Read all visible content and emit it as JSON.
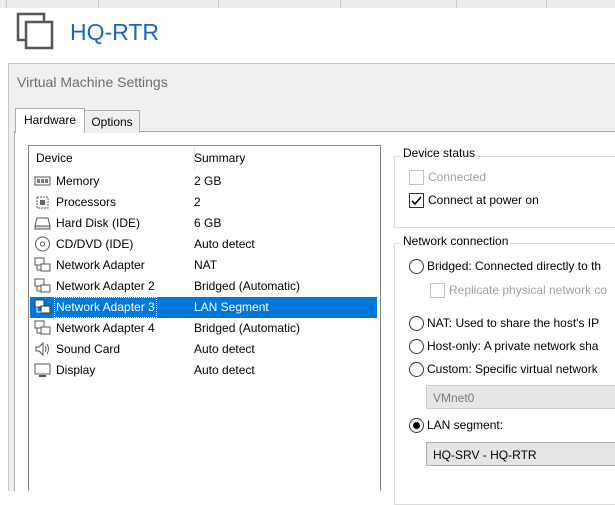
{
  "window": {
    "vm_title": "HQ-RTR",
    "dialog_title": "Virtual Machine Settings"
  },
  "tabs": [
    {
      "label": "Hardware",
      "active": true
    },
    {
      "label": "Options",
      "active": false
    }
  ],
  "device_list": {
    "headers": {
      "device": "Device",
      "summary": "Summary"
    },
    "rows": [
      {
        "icon": "memory-icon",
        "device": "Memory",
        "summary": "2 GB"
      },
      {
        "icon": "processor-icon",
        "device": "Processors",
        "summary": "2"
      },
      {
        "icon": "hard-disk-icon",
        "device": "Hard Disk (IDE)",
        "summary": "6 GB"
      },
      {
        "icon": "cd-dvd-icon",
        "device": "CD/DVD (IDE)",
        "summary": "Auto detect"
      },
      {
        "icon": "network-adapter-icon",
        "device": "Network Adapter",
        "summary": "NAT"
      },
      {
        "icon": "network-adapter-icon",
        "device": "Network Adapter 2",
        "summary": "Bridged (Automatic)"
      },
      {
        "icon": "network-adapter-icon",
        "device": "Network Adapter 3",
        "summary": "LAN Segment",
        "selected": true
      },
      {
        "icon": "network-adapter-icon",
        "device": "Network Adapter 4",
        "summary": "Bridged (Automatic)"
      },
      {
        "icon": "sound-card-icon",
        "device": "Sound Card",
        "summary": "Auto detect"
      },
      {
        "icon": "display-icon",
        "device": "Display",
        "summary": "Auto detect"
      }
    ]
  },
  "device_status": {
    "legend": "Device status",
    "connected": {
      "label": "Connected",
      "checked": false,
      "enabled": false
    },
    "connect_at_power_on": {
      "label": "Connect at power on",
      "checked": true,
      "enabled": true
    }
  },
  "network_connection": {
    "legend": "Network connection",
    "bridged": {
      "label": "Bridged: Connected directly to th",
      "selected": false
    },
    "replicate": {
      "label": "Replicate physical network co",
      "checked": false,
      "enabled": false
    },
    "nat": {
      "label": "NAT: Used to share the host's IP",
      "selected": false
    },
    "host_only": {
      "label": "Host-only: A private network sha",
      "selected": false
    },
    "custom": {
      "label": "Custom: Specific virtual network",
      "selected": false
    },
    "custom_value": "VMnet0",
    "lan_segment": {
      "label": "LAN segment:",
      "selected": true
    },
    "lan_segment_value": "HQ-SRV - HQ-RTR"
  },
  "colors": {
    "accent": "#1a66c4",
    "selection": "#0078d7"
  }
}
